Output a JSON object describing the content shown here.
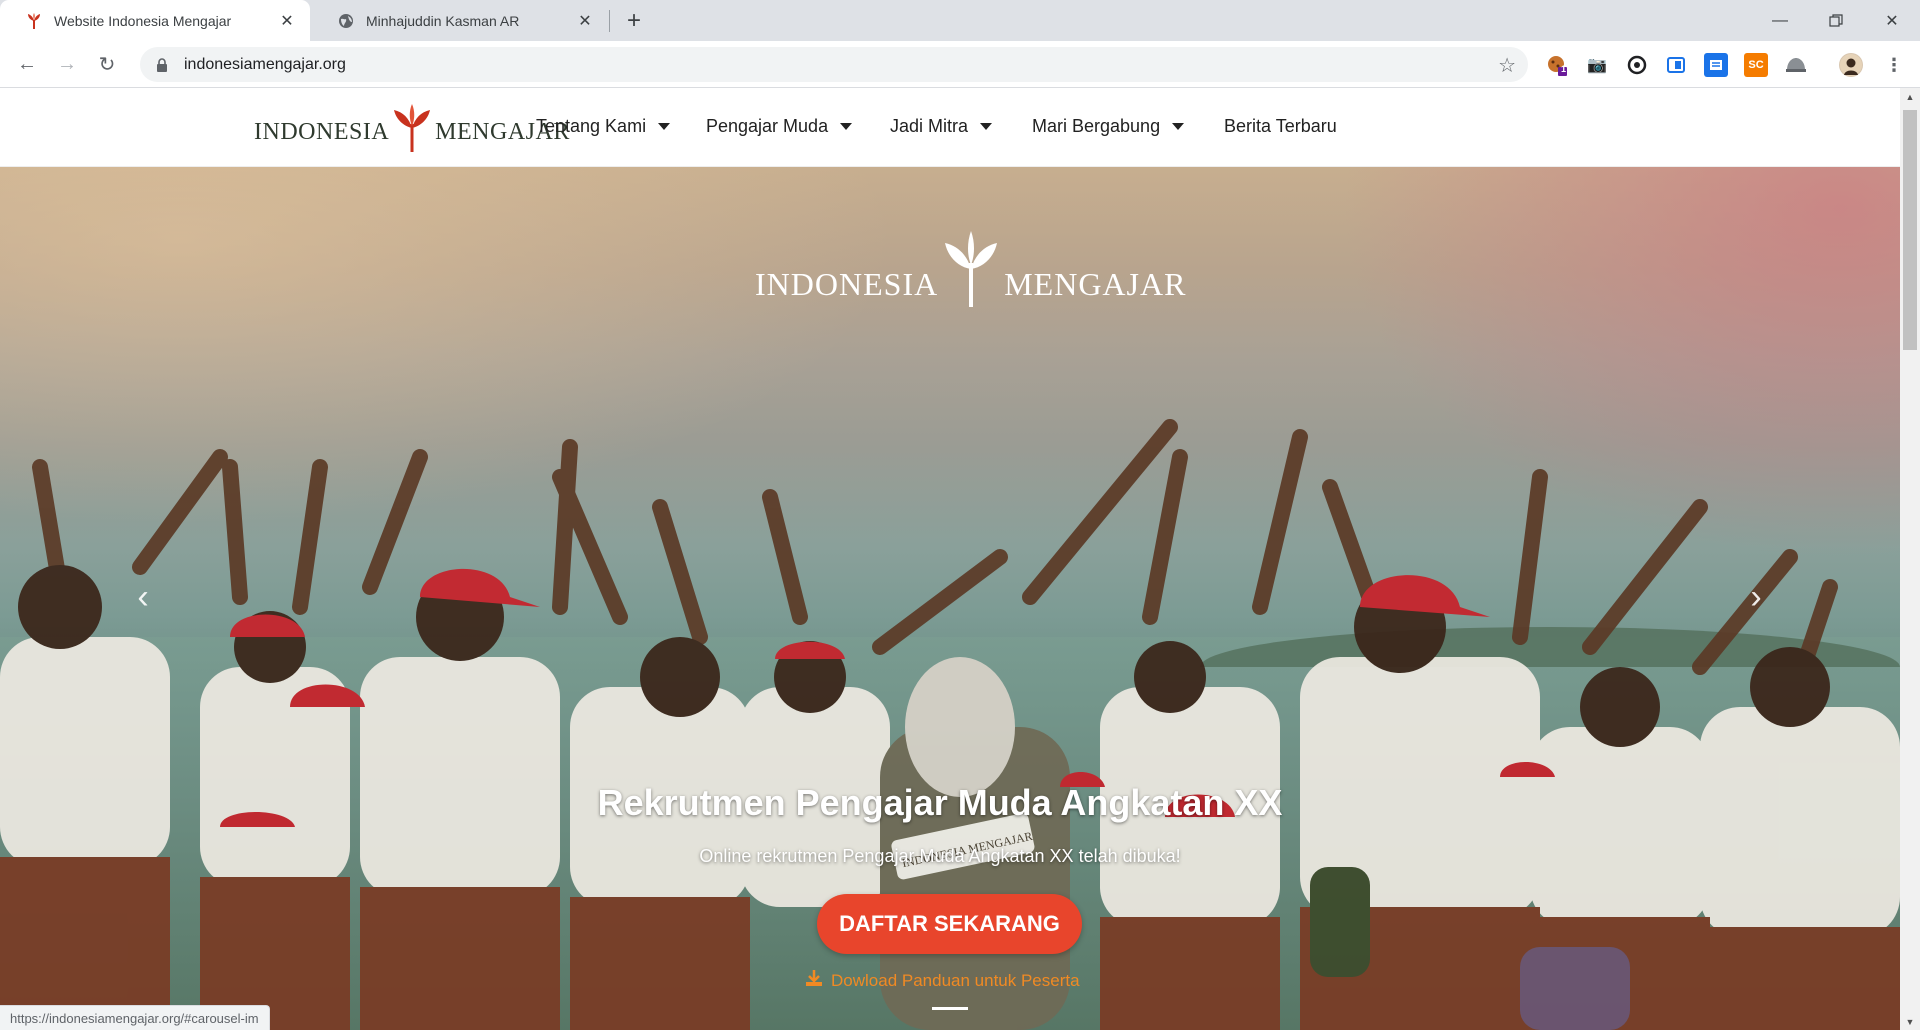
{
  "browser": {
    "tabs": [
      {
        "title": "Website Indonesia Mengajar",
        "active": true
      },
      {
        "title": "Minhajuddin Kasman AR",
        "active": false
      }
    ],
    "url": "indonesiamengajar.org",
    "extension_badge": "1",
    "extension_sc": "SC",
    "status_url": "https://indonesiamengajar.org/#carousel-im"
  },
  "site": {
    "brand_left": "INDONESIA",
    "brand_right": "MENGAJAR",
    "menu": [
      {
        "label": "Tentang Kami",
        "dropdown": true
      },
      {
        "label": "Pengajar Muda",
        "dropdown": true
      },
      {
        "label": "Jadi Mitra",
        "dropdown": true
      },
      {
        "label": "Mari Bergabung",
        "dropdown": true
      },
      {
        "label": "Berita Terbaru",
        "dropdown": false
      }
    ]
  },
  "hero": {
    "logo_left": "INDONESIA",
    "logo_right": "MENGAJAR",
    "title": "Rekrutmen Pengajar Muda Angkatan XX",
    "subtitle": "Online rekrutmen Pengajar Muda Angkatan XX telah dibuka!",
    "cta_label": "DAFTAR SEKARANG",
    "download_label": "Dowload Panduan untuk Peserta",
    "vest_text": "INDONESIA MENGAJAR"
  },
  "colors": {
    "brand_red": "#c8321e",
    "cta": "#e8452c",
    "download": "#f08a24"
  }
}
